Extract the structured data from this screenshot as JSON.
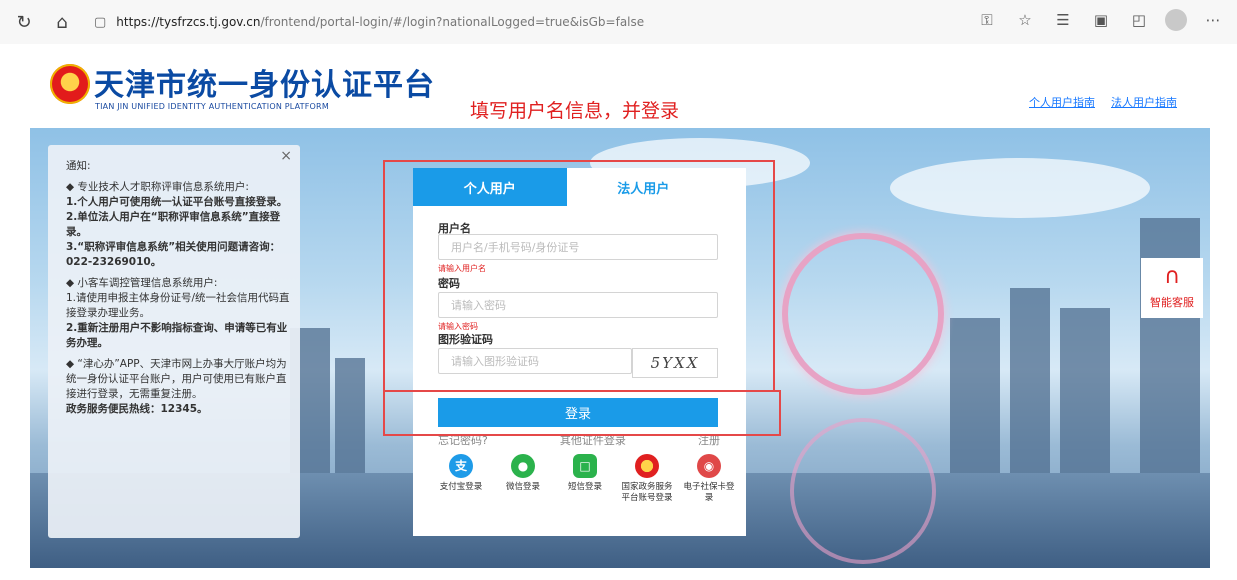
{
  "browser": {
    "url_host": "https://tysfrzcs.tj.gov.cn",
    "url_rest": "/frontend/portal-login/#/login?nationalLogged=true&isGb=false",
    "icons": [
      "refresh-icon",
      "home-icon",
      "lock-icon",
      "key-icon",
      "favorite-add-icon",
      "favorites-icon",
      "collections-icon",
      "extensions-icon",
      "profile-icon",
      "more-icon"
    ]
  },
  "header": {
    "title": "天津市统一身份认证平台",
    "subtitle": "TIAN JIN UNIFIED IDENTITY AUTHENTICATION PLATFORM",
    "instruction": "填写用户名信息，并登录",
    "links": [
      "个人用户指南",
      "法人用户指南"
    ]
  },
  "notice": {
    "close": "×",
    "heading": "通知:",
    "section1_title": "◆ 专业技术人才职称评审信息系统用户:",
    "section1_line1": "1.个人用户可使用统一认证平台账号直接登录。",
    "section1_line2": "2.单位法人用户在“职称评审信息系统”直接登录。",
    "section1_line3": "3.“职称评审信息系统”相关使用问题请咨询：022-23269010。",
    "section2_title": "◆ 小客车调控管理信息系统用户:",
    "section2_line1": "1.请使用申报主体身份证号/统一社会信用代码直接登录办理业务。",
    "section2_line2": "2.重新注册用户不影响指标查询、申请等已有业务办理。",
    "section3_line1": "◆ “津心办”APP、天津市网上办事大厅账户均为统一身份认证平台账户，用户可使用已有账户直接进行登录，无需重复注册。",
    "hotline": "政务服务便民热线：12345。"
  },
  "login": {
    "tab_personal": "个人用户",
    "tab_legal": "法人用户",
    "username_label": "用户名",
    "username_placeholder": "用户名/手机号码/身份证号",
    "username_error": "请输入用户名",
    "password_label": "密码",
    "password_placeholder": "请输入密码",
    "password_error": "请输入密码",
    "captcha_label": "图形验证码",
    "captcha_placeholder": "请输入图形验证码",
    "captcha_text": "5YXX",
    "login_button": "登录",
    "forgot": "忘记密码?",
    "other_cert": "其他证件登录",
    "register": "注册",
    "third_party": [
      {
        "label": "支付宝登录",
        "icon": "alipay-icon",
        "color": "#1e9be8"
      },
      {
        "label": "微信登录",
        "icon": "wechat-icon",
        "color": "#2bb24c"
      },
      {
        "label": "短信登录",
        "icon": "sms-icon",
        "color": "#2bb24c"
      },
      {
        "label": "国家政务服务平台账号登录",
        "icon": "national-emblem-icon",
        "color": "#e02020"
      },
      {
        "label": "电子社保卡登录",
        "icon": "social-security-card-icon",
        "color": "#e04848"
      }
    ]
  },
  "service": {
    "label": "智能客服"
  }
}
